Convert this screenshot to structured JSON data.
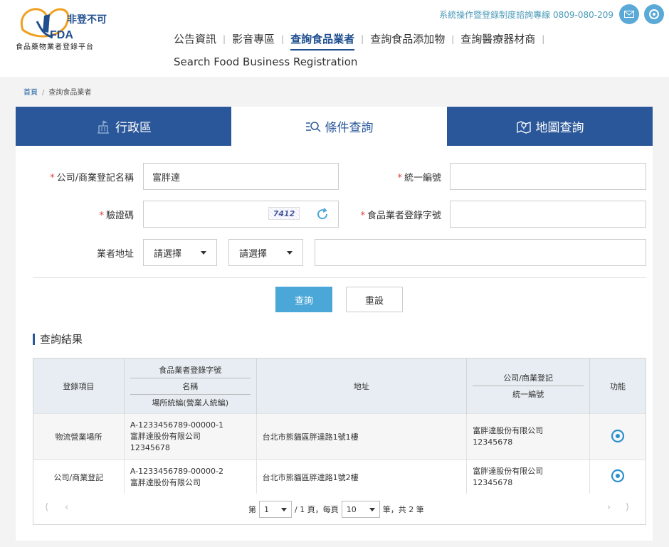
{
  "header": {
    "logo_caption": "食品藥物業者登錄平台",
    "logo_slogan": "非登不可",
    "logo_fda": "FDA",
    "hotline": "系統操作暨登錄制度諮詢專線 0809-080-209",
    "nav": [
      {
        "label": "公告資訊"
      },
      {
        "label": "影音專區"
      },
      {
        "label": "查詢食品業者"
      },
      {
        "label": "查詢食品添加物"
      },
      {
        "label": "查詢醫療器材商"
      }
    ],
    "nav_sub": "Search Food Business Registration"
  },
  "breadcrumb": {
    "home": "首頁",
    "current": "查詢食品業者"
  },
  "tabs": [
    {
      "label": "行政區",
      "icon": "building-icon"
    },
    {
      "label": "條件查詢",
      "icon": "search-list-icon"
    },
    {
      "label": "地圖查詢",
      "icon": "map-icon"
    }
  ],
  "form": {
    "company_label": "公司/商業登記名稱",
    "company_value": "富胖達",
    "tax_id_label": "統一編號",
    "captcha_label": "驗證碼",
    "captcha_code": "7412",
    "reg_no_label": "食品業者登錄字號",
    "address_label": "業者地址",
    "city_select": "請選擇",
    "district_select": "請選擇",
    "search_button": "查詢",
    "reset_button": "重設"
  },
  "results": {
    "title": "查詢結果",
    "headers": {
      "item": "登錄項目",
      "reg_no": "食品業者登錄字號",
      "name": "名稱",
      "site_id": "場所統編(營業人統編)",
      "address": "地址",
      "company_reg": "公司/商業登記",
      "company_taxid": "統一編號",
      "action": "功能"
    },
    "rows": [
      {
        "item": "物流營業場所",
        "reg_no": "A-1233456789-00000-1",
        "name": "富胖達股份有限公司",
        "site_id": "12345678",
        "address": "台北市熊貓區胖達路1號1樓",
        "company": "富胖達股份有限公司",
        "taxid": "12345678"
      },
      {
        "item": "公司/商業登記",
        "reg_no": "A-1233456789-00000-2",
        "name": "富胖達股份有限公司",
        "site_id": "",
        "address": "台北市熊貓區胖達路1號2樓",
        "company": "富胖達股份有限公司",
        "taxid": "12345678"
      }
    ],
    "pager": {
      "page_prefix": "第",
      "page": "1",
      "total_pages": "/ 1 頁，每頁",
      "per_page": "10",
      "suffix": "筆，共 2 筆",
      "first": "⟨",
      "prev": "‹",
      "next": "›",
      "last": "⟩"
    }
  },
  "colors": {
    "primary": "#2a5799",
    "accent": "#4ba7d8",
    "required": "#e0423d"
  }
}
